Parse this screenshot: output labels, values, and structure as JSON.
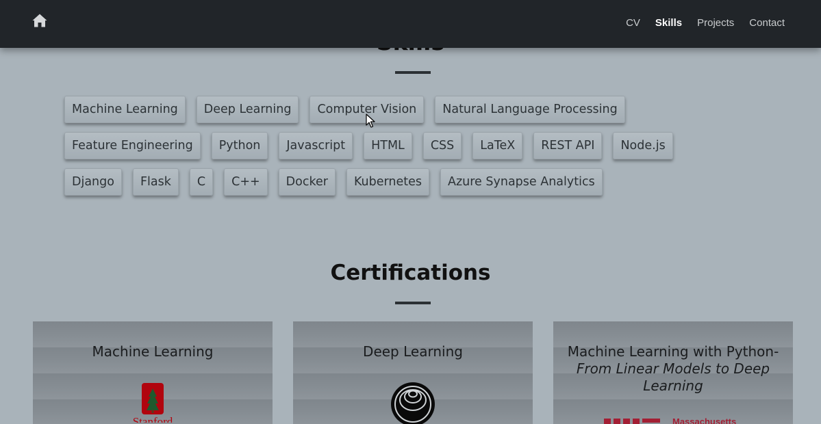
{
  "nav": {
    "home_icon": "home-icon",
    "links": [
      "CV",
      "Skills",
      "Projects",
      "Contact"
    ],
    "active": "Skills",
    "background": "#212529"
  },
  "skills": {
    "heading": "Skills",
    "rows": [
      [
        "Machine Learning",
        "Deep Learning",
        "Computer Vision",
        "Natural Language Processing"
      ],
      [
        "Feature Engineering",
        "Python",
        "Javascript",
        "HTML",
        "CSS",
        "LaTeX",
        "REST API",
        "Node.js"
      ],
      [
        "Django",
        "Flask",
        "C",
        "C++",
        "Docker",
        "Kubernetes",
        "Azure Synapse Analytics"
      ]
    ]
  },
  "certifications": {
    "heading": "Certifications",
    "cards": [
      {
        "title": "Machine Learning",
        "title_italic": "",
        "logo": "stanford-logo",
        "logo_text": "Stanford"
      },
      {
        "title": "Deep Learning",
        "title_italic": "",
        "logo": "deeplearning-ai-logo",
        "logo_text": ""
      },
      {
        "title": "Machine Learning with Python-",
        "title_italic": "From Linear Models to Deep Learning",
        "logo": "mit-logo",
        "logo_text": "Massachusetts"
      }
    ]
  },
  "colors": {
    "page_background": "#a9b3ba",
    "card_background": "#868d93",
    "stanford_red": "#b1040e",
    "mit_red": "#a31f34"
  }
}
